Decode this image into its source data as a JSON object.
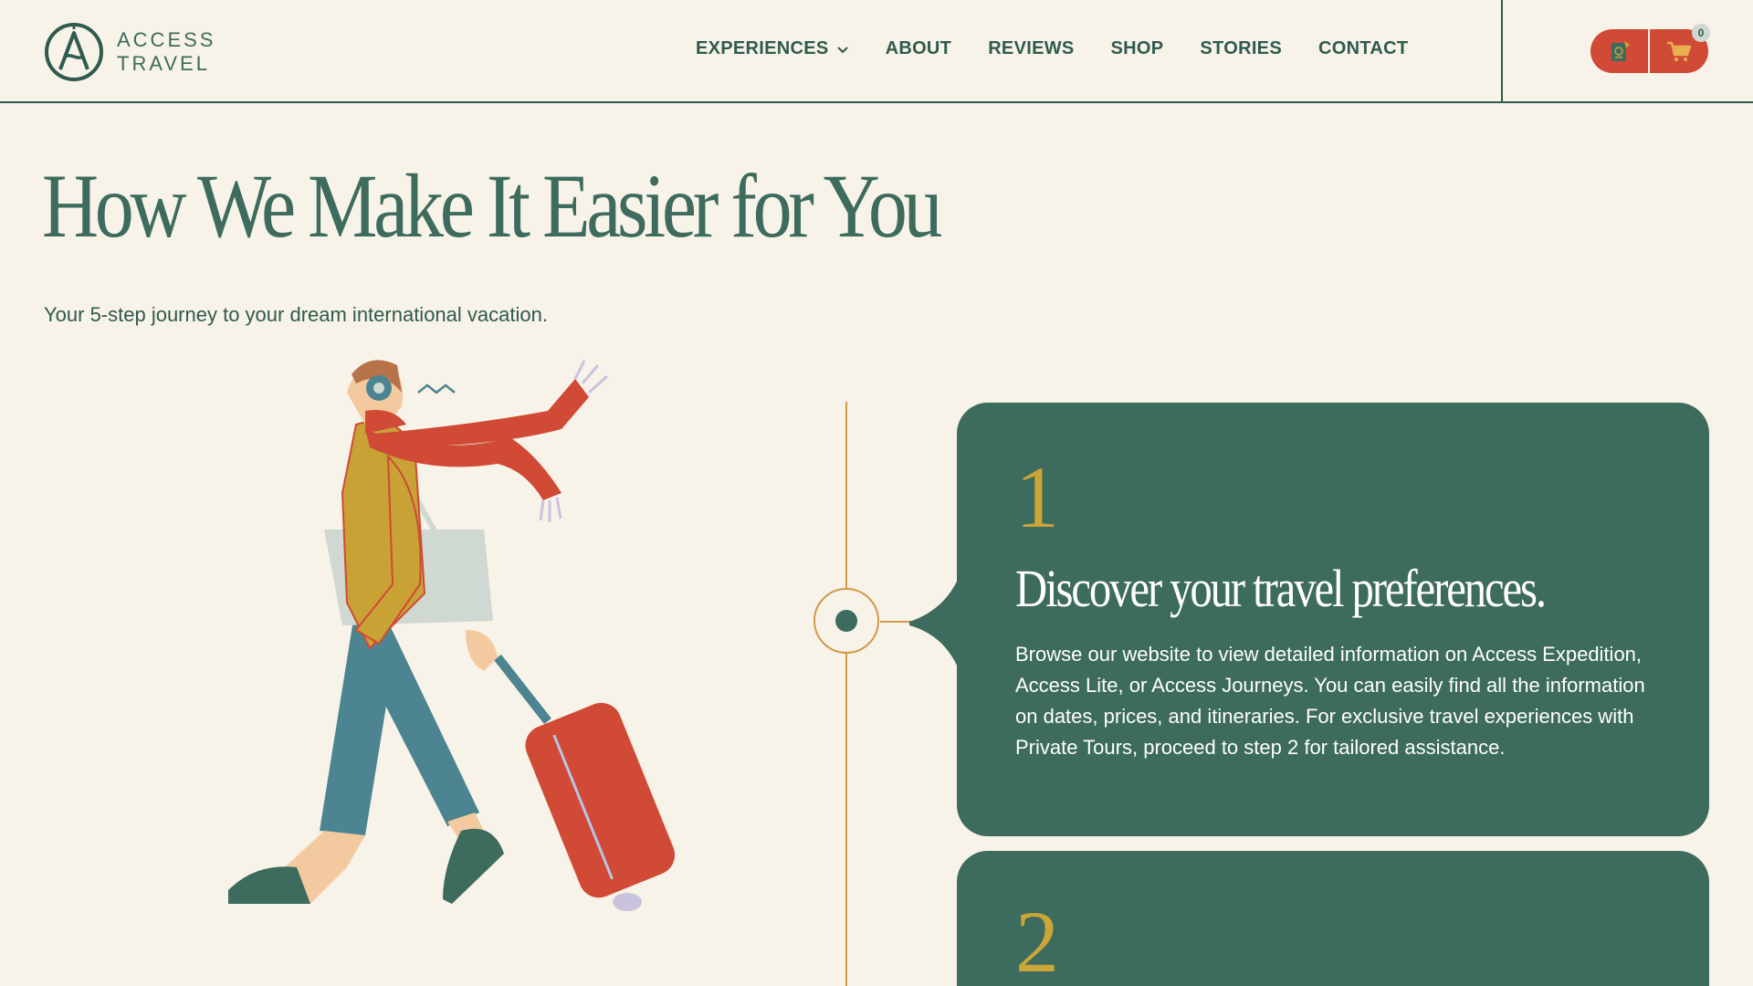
{
  "brand": {
    "line1": "ACCESS",
    "line2": "TRAVEL",
    "mark_letter": "A"
  },
  "nav": {
    "items": [
      {
        "label": "EXPERIENCES",
        "has_dropdown": true
      },
      {
        "label": "ABOUT"
      },
      {
        "label": "REVIEWS"
      },
      {
        "label": "SHOP"
      },
      {
        "label": "STORIES"
      },
      {
        "label": "CONTACT"
      }
    ]
  },
  "actions": {
    "passport_icon": "passport-icon",
    "cart_icon": "cart-icon",
    "cart_count": "0"
  },
  "hero": {
    "title": "How We Make It Easier for You",
    "subtitle": "Your 5-step journey to your dream international vacation."
  },
  "steps": [
    {
      "number": "1",
      "title": "Discover your travel preferences.",
      "description": "Browse our website to view detailed information on Access Expedition, Access Lite, or Access Journeys. You can easily find all the information on dates, prices, and itineraries. For exclusive travel experiences with Private Tours, proceed to step 2 for tailored assistance."
    },
    {
      "number": "2"
    }
  ],
  "colors": {
    "background": "#f8f3e8",
    "primary_green": "#3d6b5e",
    "accent_red": "#d04a35",
    "accent_gold": "#c9a636",
    "timeline": "#d09a4a"
  }
}
